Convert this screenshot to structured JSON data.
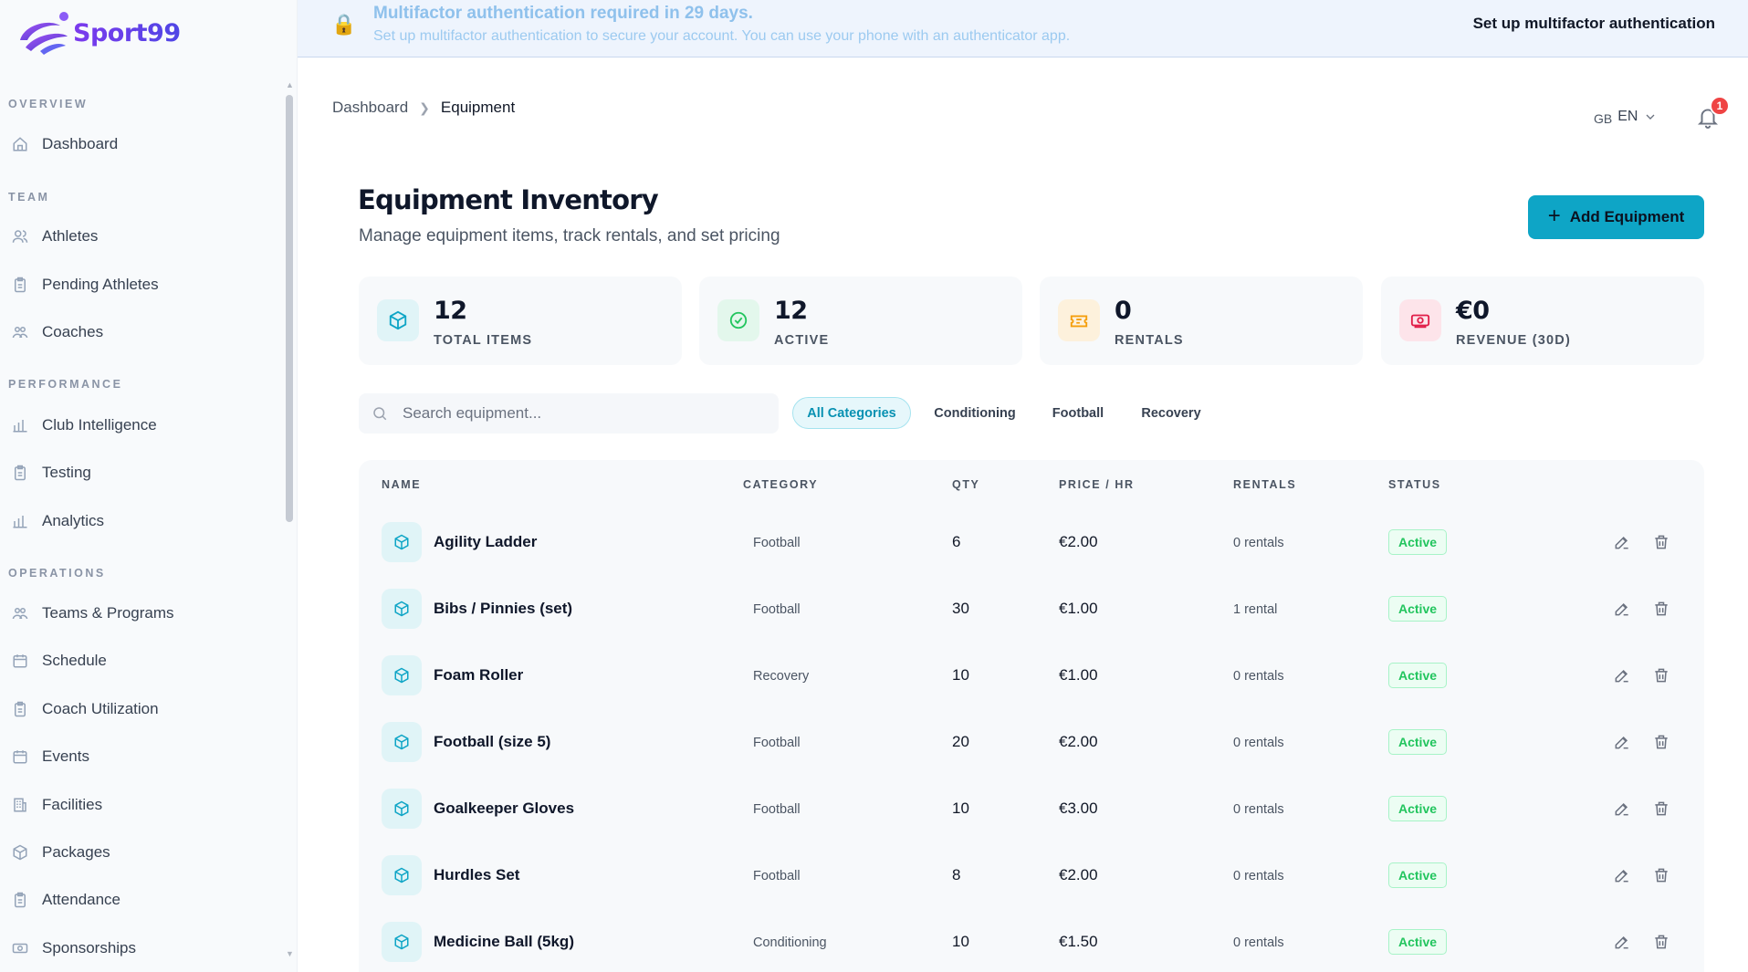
{
  "brand": {
    "name": "Sport99"
  },
  "sidebar": {
    "sections": [
      {
        "label": "OVERVIEW"
      },
      {
        "label": "TEAM"
      },
      {
        "label": "PERFORMANCE"
      },
      {
        "label": "OPERATIONS"
      }
    ],
    "items": [
      {
        "label": "Dashboard",
        "icon": "home-icon"
      },
      {
        "label": "Athletes",
        "icon": "users-icon"
      },
      {
        "label": "Pending Athletes",
        "icon": "clipboard-icon"
      },
      {
        "label": "Coaches",
        "icon": "users-icon"
      },
      {
        "label": "Club Intelligence",
        "icon": "bar-chart-icon"
      },
      {
        "label": "Testing",
        "icon": "clipboard-icon"
      },
      {
        "label": "Analytics",
        "icon": "bar-chart-icon"
      },
      {
        "label": "Teams & Programs",
        "icon": "users-icon"
      },
      {
        "label": "Schedule",
        "icon": "calendar-icon"
      },
      {
        "label": "Coach Utilization",
        "icon": "clipboard-icon"
      },
      {
        "label": "Events",
        "icon": "calendar-icon"
      },
      {
        "label": "Facilities",
        "icon": "building-icon"
      },
      {
        "label": "Packages",
        "icon": "box-icon"
      },
      {
        "label": "Attendance",
        "icon": "clipboard-icon"
      },
      {
        "label": "Sponsorships",
        "icon": "banknote-icon"
      }
    ]
  },
  "banner": {
    "title": "Multifactor authentication required in 29 days.",
    "subtitle": "Set up multifactor authentication to secure your account. You can use your phone with an authenticator app.",
    "action": "Set up multifactor authentication"
  },
  "breadcrumb": {
    "parent": "Dashboard",
    "current": "Equipment"
  },
  "language": {
    "flag": "GB",
    "code": "EN"
  },
  "notifications": {
    "count": "1"
  },
  "header": {
    "title": "Equipment Inventory",
    "subtitle": "Manage equipment items, track rentals, and set pricing",
    "add_button": "Add Equipment"
  },
  "stats": [
    {
      "value": "12",
      "label": "TOTAL ITEMS",
      "icon": "box-icon",
      "color": "#0ea5c6"
    },
    {
      "value": "12",
      "label": "ACTIVE",
      "icon": "check-circle-icon",
      "color": "#22c55e"
    },
    {
      "value": "0",
      "label": "RENTALS",
      "icon": "ticket-icon",
      "color": "#f59e0b"
    },
    {
      "value": "€0",
      "label": "REVENUE (30D)",
      "icon": "banknote-icon",
      "color": "#e11d48"
    }
  ],
  "search": {
    "placeholder": "Search equipment..."
  },
  "filters": [
    "All Categories",
    "Conditioning",
    "Football",
    "Recovery"
  ],
  "table": {
    "columns": [
      "NAME",
      "CATEGORY",
      "QTY",
      "PRICE / HR",
      "RENTALS",
      "STATUS"
    ],
    "rows": [
      {
        "name": "Agility Ladder",
        "category": "Football",
        "qty": "6",
        "price": "€2.00",
        "rentals": "0 rentals",
        "status": "Active"
      },
      {
        "name": "Bibs / Pinnies (set)",
        "category": "Football",
        "qty": "30",
        "price": "€1.00",
        "rentals": "1 rental",
        "status": "Active"
      },
      {
        "name": "Foam Roller",
        "category": "Recovery",
        "qty": "10",
        "price": "€1.00",
        "rentals": "0 rentals",
        "status": "Active"
      },
      {
        "name": "Football (size 5)",
        "category": "Football",
        "qty": "20",
        "price": "€2.00",
        "rentals": "0 rentals",
        "status": "Active"
      },
      {
        "name": "Goalkeeper Gloves",
        "category": "Football",
        "qty": "10",
        "price": "€3.00",
        "rentals": "0 rentals",
        "status": "Active"
      },
      {
        "name": "Hurdles Set",
        "category": "Football",
        "qty": "8",
        "price": "€2.00",
        "rentals": "0 rentals",
        "status": "Active"
      },
      {
        "name": "Medicine Ball (5kg)",
        "category": "Conditioning",
        "qty": "10",
        "price": "€1.50",
        "rentals": "0 rentals",
        "status": "Active"
      }
    ]
  },
  "colors": {
    "accent": "#0ea5c6",
    "brand": "#7c3aed",
    "status_active": "#22c55e",
    "badge": "#ef4444"
  }
}
